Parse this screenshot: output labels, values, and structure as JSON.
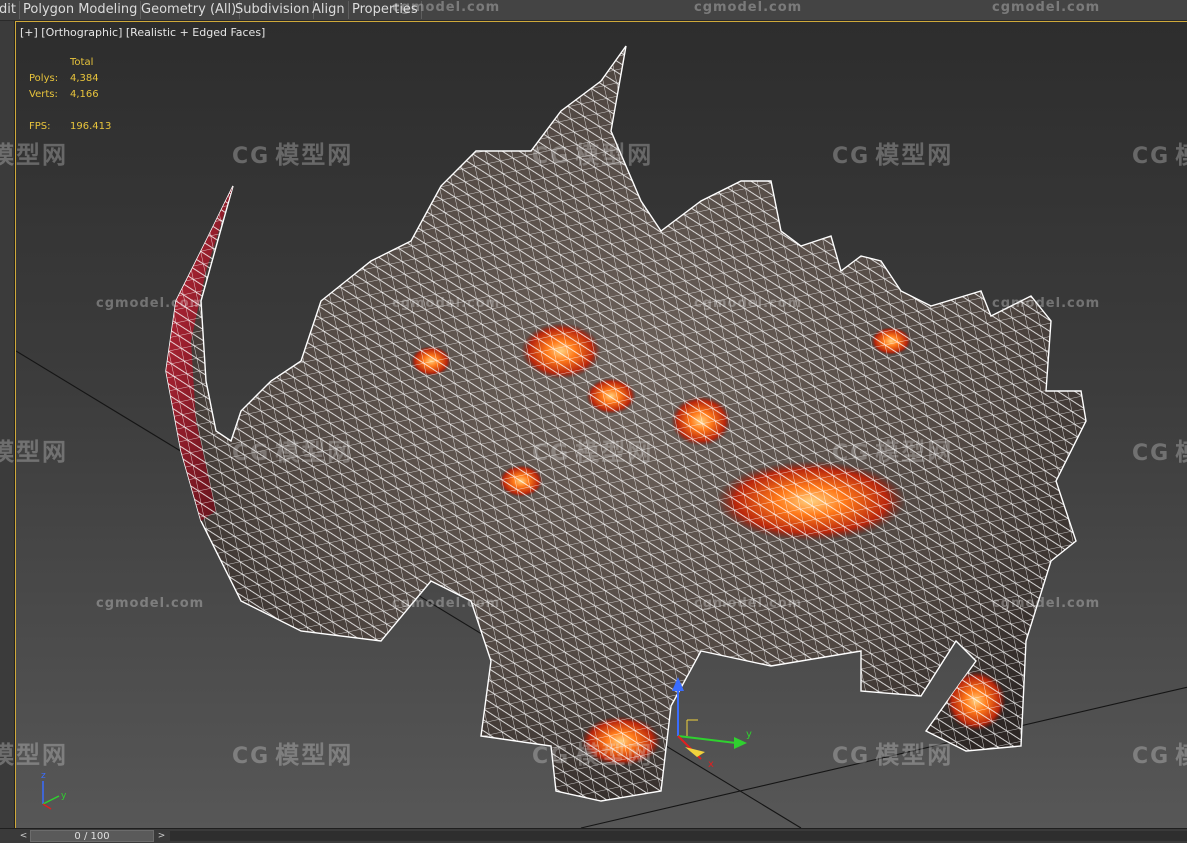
{
  "ribbon": {
    "tabs": [
      "dit",
      "Polygon Modeling",
      "Geometry (All)",
      "Subdivision",
      "Align",
      "Properties"
    ]
  },
  "viewport": {
    "label": "[+] [Orthographic] [Realistic + Edged Faces]",
    "stats": {
      "header": "Total",
      "polys_label": "Polys:",
      "polys_value": "4,384",
      "verts_label": "Verts:",
      "verts_value": "4,166",
      "fps_label": "FPS:",
      "fps_value": "196.413"
    },
    "gizmo_axis_label": "y",
    "gizmo_axis_label_x": "x",
    "axis_tripod": {
      "z": "z",
      "y": "y",
      "x": "x"
    }
  },
  "timeline": {
    "prev_icon": "<",
    "frame_text": "0 / 100",
    "next_icon": ">"
  },
  "watermark": {
    "brand_cn": "模型网",
    "brand_en": "cgmodel.com",
    "logo_text": "CG"
  },
  "colors": {
    "viewport_border": "#cfa93a",
    "stats_text": "#e8c43c",
    "wireframe": "#ffffff",
    "lava": "#e85a10",
    "rock": "#5a4f49"
  },
  "icons": [
    "chevron-left-icon",
    "chevron-right-icon",
    "move-gizmo-icon",
    "axis-tripod-icon",
    "cg-logo-icon"
  ]
}
